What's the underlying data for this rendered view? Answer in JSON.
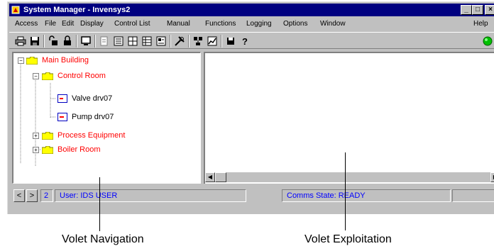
{
  "titlebar": {
    "title": "System Manager - Invensys2",
    "minimize": "_",
    "maximize": "□",
    "close": "×"
  },
  "menubar": {
    "items": [
      "Access",
      "File",
      "Edit",
      "Display",
      "Control List",
      "Manual",
      "Functions",
      "Logging",
      "Options",
      "Window",
      "Help"
    ]
  },
  "tree": {
    "root": "Main Building",
    "control_room": "Control Room",
    "valve": "Valve drv07",
    "pump": "Pump drv07",
    "process": "Process Equipment",
    "boiler": "Boiler Room",
    "expand_minus": "−",
    "expand_plus": "+"
  },
  "statusbar": {
    "prev": "<",
    "next": ">",
    "page": "2",
    "user": "User: IDS USER",
    "comms": "Comms State: READY"
  },
  "captions": {
    "left": "Volet Navigation",
    "right": "Volet Exploitation"
  },
  "colors": {
    "title_bg": "#000080",
    "tree_red": "#ff0000",
    "status_text": "#0000ff"
  }
}
